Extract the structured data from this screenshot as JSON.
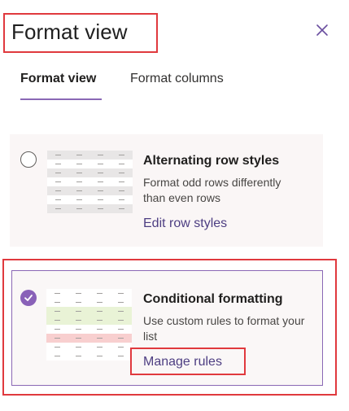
{
  "header": {
    "title": "Format view",
    "close_icon": "close-icon"
  },
  "tabs": [
    {
      "label": "Format view",
      "active": true
    },
    {
      "label": "Format columns",
      "active": false
    }
  ],
  "options": [
    {
      "title": "Alternating row styles",
      "description": "Format odd rows differently than even rows",
      "link": "Edit row styles",
      "selected": false
    },
    {
      "title": "Conditional formatting",
      "description": "Use custom rules to format your list",
      "link": "Manage rules",
      "selected": true
    }
  ],
  "colors": {
    "accent": "#8a68b5",
    "highlight": "#e0393e",
    "link": "#4d3e82",
    "card_background": "#faf6f6",
    "row_gray": "#e8e6e6",
    "row_green": "#e9f3d6",
    "row_red": "#f8cfcf"
  },
  "previews": {
    "alternating": [
      "#e8e6e6",
      "#ffffff",
      "#e8e6e6",
      "#ffffff",
      "#e8e6e6",
      "#ffffff",
      "#e8e6e6"
    ],
    "conditional": [
      "#ffffff",
      "#ffffff",
      "#e9f3d6",
      "#e9f3d6",
      "#ffffff",
      "#f8cfcf",
      "#ffffff",
      "#ffffff"
    ]
  }
}
